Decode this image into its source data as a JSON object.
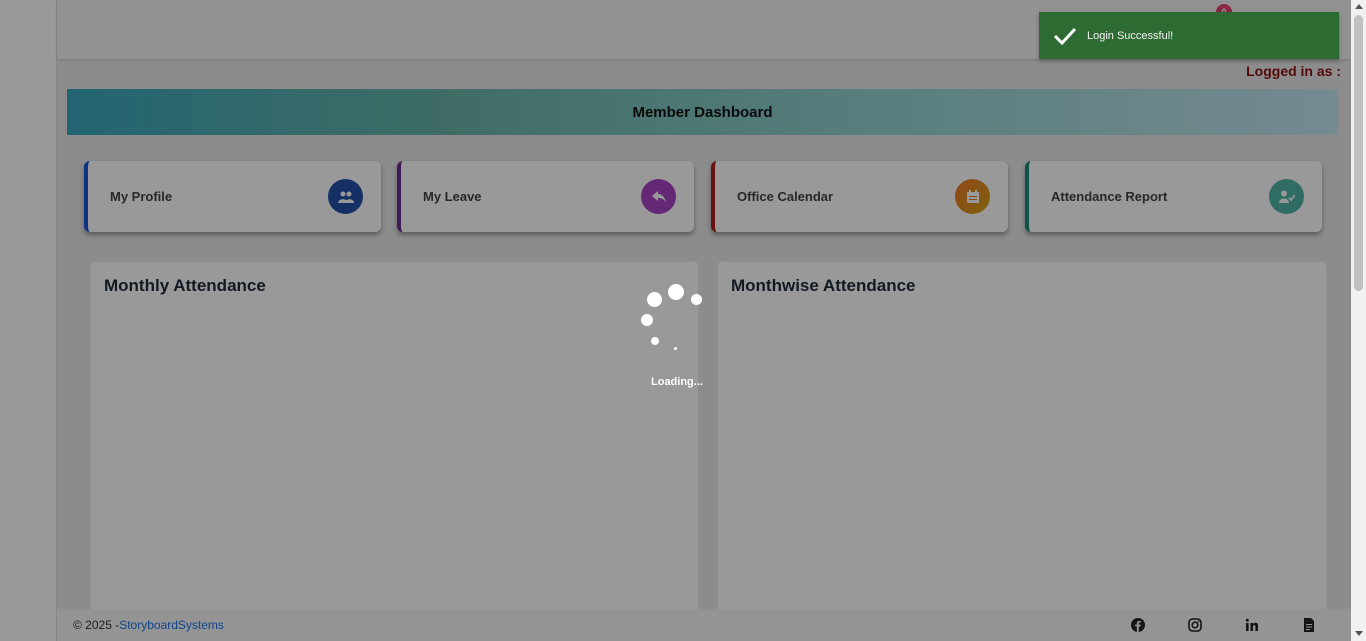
{
  "header": {
    "notification_count": "0",
    "logged_in_label": "Logged in as :"
  },
  "banner": {
    "title": "Member Dashboard"
  },
  "cards": [
    {
      "label": "My Profile",
      "icon": "users-icon",
      "accent": "#1a56db",
      "icon_bg": "#2450a8"
    },
    {
      "label": "My Leave",
      "icon": "reply-arrow-icon",
      "accent": "#6d2a8e",
      "icon_bg": "#a944c4"
    },
    {
      "label": "Office Calendar",
      "icon": "calendar-icon",
      "accent": "#b01d1d",
      "icon_bg": "#f07a2a"
    },
    {
      "label": "Attendance Report",
      "icon": "user-check-icon",
      "accent": "#1a8a7a",
      "icon_bg": "#4fb5a6"
    }
  ],
  "panels": {
    "monthly_title": "Monthly Attendance",
    "monthwise_title": "Monthwise Attendance"
  },
  "loader": {
    "text": "Loading..."
  },
  "toast": {
    "message": "Login Successful!",
    "icon": "checkmark-icon",
    "color": "#2e6b33"
  },
  "footer": {
    "copyright": "© 2025 - ",
    "company": "StoryboardSystems",
    "social_icons": [
      "facebook-icon",
      "instagram-icon",
      "linkedin-icon",
      "document-icon"
    ]
  }
}
